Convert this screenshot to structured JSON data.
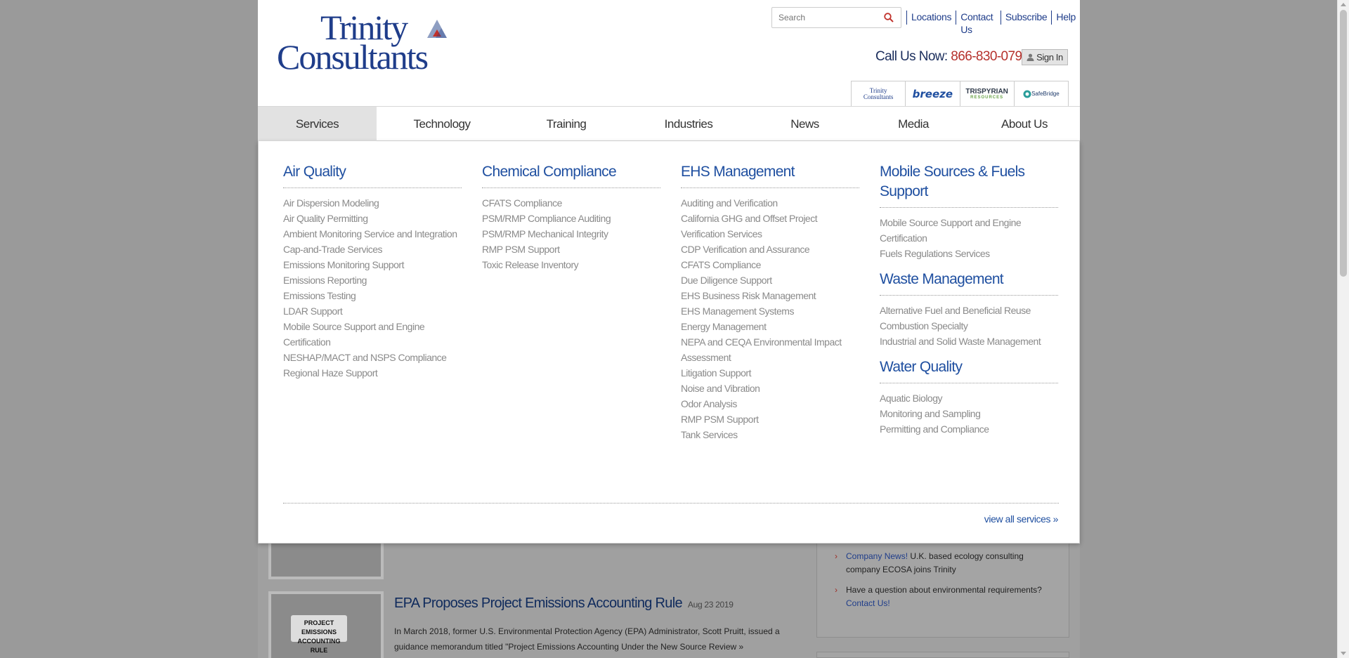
{
  "header": {
    "logo_text_top": "Trinity",
    "logo_text_bottom": "Consultants",
    "search": {
      "placeholder": "Search"
    },
    "utility_links": [
      {
        "label": "Locations"
      },
      {
        "label": "Contact Us"
      },
      {
        "label": "Subscribe"
      },
      {
        "label": "Help"
      }
    ],
    "call_label": "Call Us Now:",
    "phone": "866-830-0796",
    "signin_label": "Sign In",
    "brand_tabs": [
      {
        "label_top": "Trinity",
        "label_bottom": "Consultants"
      },
      {
        "label": "breeze"
      },
      {
        "label": "TRISPYRIAN",
        "sub": "RESOURCES"
      },
      {
        "label": "SafeBridge"
      }
    ]
  },
  "nav": {
    "items": [
      {
        "label": "Services"
      },
      {
        "label": "Technology"
      },
      {
        "label": "Training"
      },
      {
        "label": "Industries"
      },
      {
        "label": "News"
      },
      {
        "label": "Media"
      },
      {
        "label": "About Us"
      }
    ]
  },
  "mega_menu": {
    "columns": [
      {
        "sections": [
          {
            "heading": "Air Quality",
            "links": [
              "Air Dispersion Modeling",
              "Air Quality Permitting",
              "Ambient Monitoring Service and Integration",
              "Cap-and-Trade Services",
              "Emissions Monitoring Support",
              "Emissions Reporting",
              "Emissions Testing",
              "LDAR Support",
              "Mobile Source Support and Engine Certification",
              "NESHAP/MACT and NSPS Compliance",
              "Regional Haze Support"
            ]
          }
        ]
      },
      {
        "sections": [
          {
            "heading": "Chemical Compliance",
            "links": [
              "CFATS Compliance",
              "PSM/RMP Compliance Auditing",
              "PSM/RMP Mechanical Integrity",
              "RMP PSM Support",
              "Toxic Release Inventory"
            ]
          }
        ]
      },
      {
        "sections": [
          {
            "heading": "EHS Management",
            "links": [
              "Auditing and Verification",
              "California GHG and Offset Project Verification Services",
              "CDP Verification and Assurance",
              "CFATS Compliance",
              "Due Diligence Support",
              "EHS Business Risk Management",
              "EHS Management Systems",
              "Energy Management",
              "NEPA and CEQA Environmental Impact Assessment",
              "Litigation Support",
              "Noise and Vibration",
              "Odor Analysis",
              "RMP PSM Support",
              "Tank Services"
            ]
          }
        ]
      },
      {
        "sections": [
          {
            "heading": "Mobile Sources & Fuels Support",
            "links": [
              "Mobile Source Support and Engine Certification",
              "Fuels Regulations Services"
            ]
          },
          {
            "heading": "Waste Management",
            "links": [
              "Alternative Fuel and Beneficial Reuse",
              "Combustion Specialty",
              "Industrial and Solid Waste Management"
            ]
          },
          {
            "heading": "Water Quality",
            "links": [
              "Aquatic Biology",
              "Monitoring and Sampling",
              "Permitting and Compliance"
            ]
          }
        ]
      }
    ],
    "view_all": "view all services »"
  },
  "articles": [
    {
      "title": "EPA Proposes Project Emissions Accounting Rule",
      "date": "Aug 23 2019",
      "text": "In March 2018, former U.S. Environmental Protection Agency (EPA) Administrator, Scott Pruitt, issued a guidance memorandum titled \"Project Emissions Accounting Under the New Source Review »",
      "thumb_label": "PROJECT EMISSIONS ACCOUNTING RULE"
    }
  ],
  "sidebar": {
    "items": [
      {
        "highlight": "Company News!",
        "text": " U.K. based ecology consulting company ECOSA joins Trinity"
      },
      {
        "text": "Have a question about environmental requirements? ",
        "highlight": "Contact Us!"
      }
    ]
  },
  "colors": {
    "brand_blue": "#1f4fa0",
    "phone_red": "#b5302b",
    "overlay_gray": "#9f9f9f"
  }
}
